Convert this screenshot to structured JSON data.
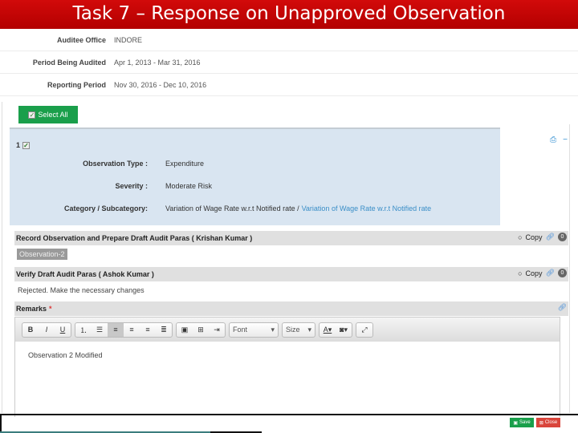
{
  "title": "Task 7 – Response on Unapproved Observation",
  "info": [
    {
      "label": "Auditee Office",
      "value": "INDORE"
    },
    {
      "label": "Period Being Audited",
      "value": "Apr 1, 2013 - Mar 31, 2016"
    },
    {
      "label": "Reporting Period",
      "value": "Nov 30, 2016 - Dec 10, 2016"
    }
  ],
  "select_all_label": "Select All",
  "observation": {
    "number": "1",
    "checked": true,
    "type_label": "Observation Type :",
    "type_value": "Expenditure",
    "severity_label": "Severity :",
    "severity_value": "Moderate Risk",
    "category_label": "Category / Subcategory:",
    "category_value": "Variation of Wage Rate w.r.t Notified rate /",
    "subcategory_value": "Variation of Wage Rate w.r.t Notified rate"
  },
  "sections": {
    "record": {
      "heading": "Record Observation and Prepare Draft Audit Paras ( Krishan Kumar )",
      "tag": "Observation-2",
      "copy_label": "Copy",
      "badge": "0"
    },
    "verify": {
      "heading": "Verify Draft Audit Paras ( Ashok Kumar )",
      "text": "Rejected. Make the necessary changes",
      "copy_label": "Copy",
      "badge": "0"
    },
    "remarks": {
      "heading": "Remarks",
      "required_mark": "*"
    }
  },
  "editor": {
    "font_label": "Font",
    "size_label": "Size",
    "content": "Observation 2 Modified"
  },
  "buttons": {
    "save": "Save",
    "close": "Close"
  }
}
